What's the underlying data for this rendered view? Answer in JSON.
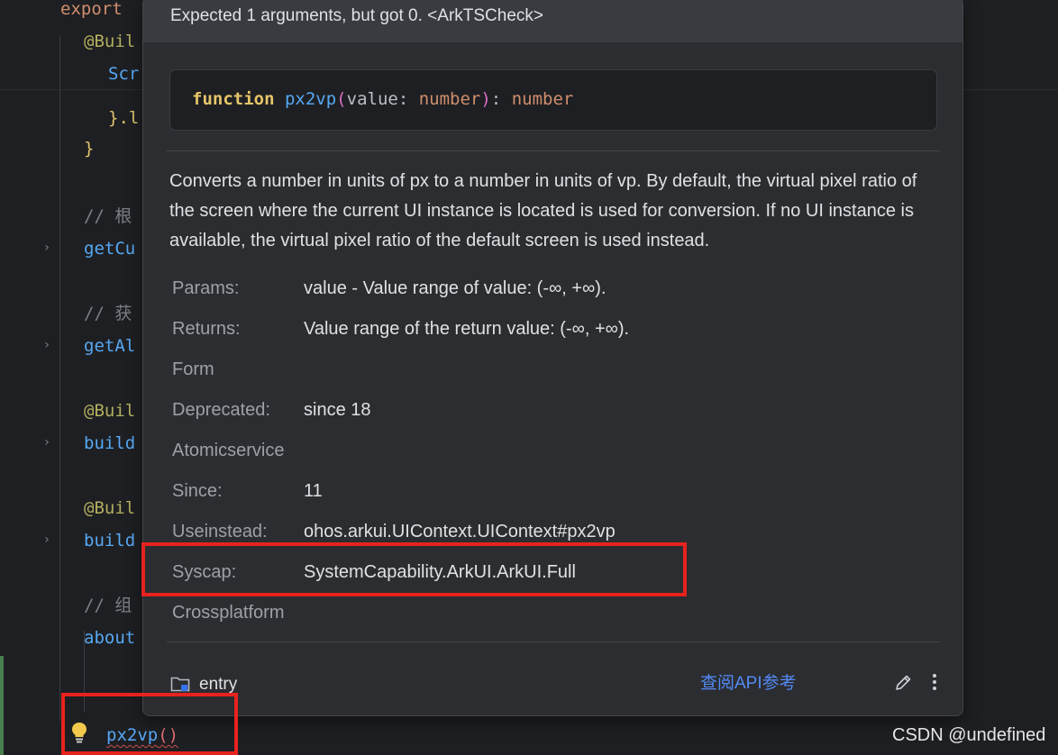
{
  "editor": {
    "lines": {
      "export": "export",
      "builder1": "@Buil",
      "scr": "Scr",
      "dotl": "}.l",
      "close_brace": "}",
      "comment1": "// 根",
      "getcu": "getCu",
      "comment2": "// 获",
      "getal": "getAl",
      "builder2": "@Buil",
      "build1": "build",
      "builder3": "@Buil",
      "build2": "build",
      "comment3": "// 组",
      "about": "about",
      "call_name": "px2vp",
      "call_parens": "()"
    }
  },
  "popup": {
    "error": "Expected 1 arguments, but got 0. <ArkTSCheck>",
    "signature": {
      "keyword": "function",
      "name": "px2vp",
      "open": "(",
      "param": "value: ",
      "param_type": "number",
      "close": ")",
      "colon": ": ",
      "return_type": "number"
    },
    "description": "Converts a number in units of px to a number in units of vp. By default, the virtual pixel ratio of the screen where the current UI instance is located is used for conversion. If no UI instance is available, the virtual pixel ratio of the default screen is used instead.",
    "rows": [
      {
        "label": "Params:",
        "value": "value - Value range of value: (-∞, +∞)."
      },
      {
        "label": "Returns:",
        "value": "Value range of the return value: (-∞, +∞)."
      },
      {
        "label": "Form",
        "value": ""
      },
      {
        "label": "Deprecated:",
        "value": "since 18"
      },
      {
        "label": "Atomicservice",
        "value": ""
      },
      {
        "label": "Since:",
        "value": "11"
      },
      {
        "label": "Useinstead:",
        "value": "ohos.arkui.UIContext.UIContext#px2vp"
      },
      {
        "label": "Syscap:",
        "value": "SystemCapability.ArkUI.ArkUI.Full"
      },
      {
        "label": "Crossplatform",
        "value": ""
      }
    ],
    "footer": {
      "module": "entry",
      "api_link": "查阅API参考"
    }
  },
  "watermark": "CSDN @undefined",
  "icons": [
    "folder-module-icon",
    "pencil-icon",
    "more-vertical-icon",
    "lightbulb-icon",
    "chevron-right-icon"
  ],
  "colors": {
    "annotation": "#e8221f",
    "link": "#548af7",
    "popup_bg": "#2b2d30",
    "editor_bg": "#1e1f22"
  }
}
